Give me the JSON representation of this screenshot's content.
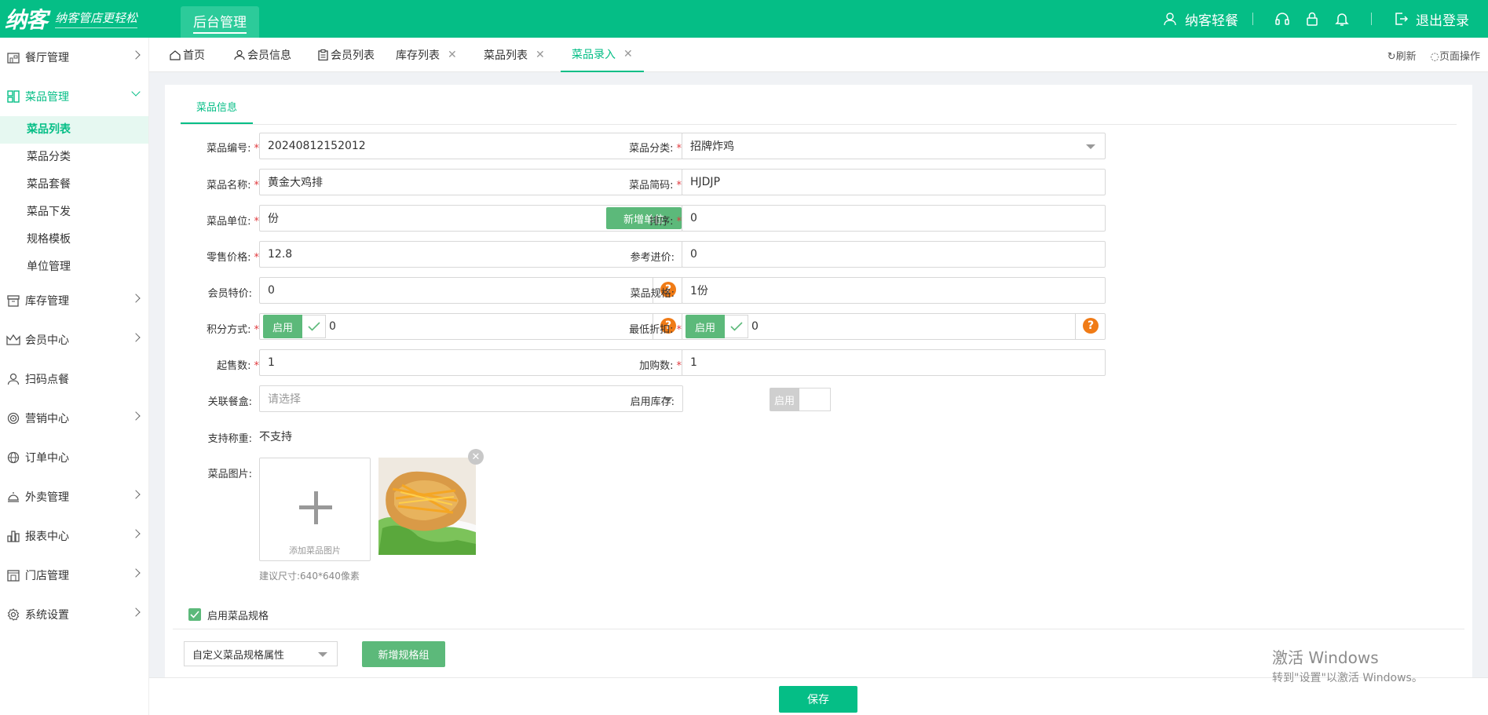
{
  "header": {
    "logo": "纳客",
    "slogan": "纳客管店更轻松",
    "module_tab": "后台管理",
    "user": "纳客轻餐",
    "logout": "退出登录"
  },
  "sidebar": {
    "groups": [
      {
        "label": "餐厅管理",
        "icon": "restaurant-icon"
      },
      {
        "label": "菜品管理",
        "icon": "dish-icon"
      },
      {
        "label": "库存管理",
        "icon": "inventory-icon"
      },
      {
        "label": "会员中心",
        "icon": "crown-icon"
      },
      {
        "label": "扫码点餐",
        "icon": "user-icon"
      },
      {
        "label": "营销中心",
        "icon": "target-icon"
      },
      {
        "label": "订单中心",
        "icon": "globe-icon"
      },
      {
        "label": "外卖管理",
        "icon": "cloche-icon"
      },
      {
        "label": "报表中心",
        "icon": "chart-icon"
      },
      {
        "label": "门店管理",
        "icon": "store-icon"
      },
      {
        "label": "系统设置",
        "icon": "gear-icon"
      }
    ],
    "dish_submenu": [
      "菜品列表",
      "菜品分类",
      "菜品套餐",
      "菜品下发",
      "规格模板",
      "单位管理"
    ]
  },
  "tabs": {
    "items": [
      {
        "label": "首页"
      },
      {
        "label": "会员信息"
      },
      {
        "label": "会员列表"
      },
      {
        "label": "库存列表"
      },
      {
        "label": "菜品列表"
      },
      {
        "label": "菜品录入"
      }
    ],
    "refresh": "刷新",
    "page_ops": "页面操作"
  },
  "form": {
    "section_tab": "菜品信息",
    "dish_code": {
      "label": "菜品编号:",
      "value": "20240812152012"
    },
    "dish_name": {
      "label": "菜品名称:",
      "value": "黄金大鸡排"
    },
    "dish_unit": {
      "label": "菜品单位:",
      "value": "份",
      "button": "新增单位"
    },
    "retail_price": {
      "label": "零售价格:",
      "value": "12.8"
    },
    "member_price": {
      "label": "会员特价:",
      "value": "0"
    },
    "points_mode": {
      "label": "积分方式:",
      "toggle": "启用",
      "value": "0"
    },
    "min_qty": {
      "label": "起售数:",
      "value": "1"
    },
    "lunchbox": {
      "label": "关联餐盒:",
      "placeholder": "请选择"
    },
    "weighing": {
      "label": "支持称重:",
      "value": "不支持"
    },
    "dish_image": {
      "label": "菜品图片:",
      "upload_text": "添加菜品图片",
      "hint": "建议尺寸:640*640像素"
    },
    "category": {
      "label": "菜品分类:",
      "value": "招牌炸鸡"
    },
    "short_code": {
      "label": "菜品简码:",
      "value": "HJDJP"
    },
    "sort": {
      "label": "排序:",
      "value": "0"
    },
    "ref_cost": {
      "label": "参考进价:",
      "value": "0"
    },
    "spec": {
      "label": "菜品规格:",
      "value": "1份"
    },
    "min_discount": {
      "label": "最低折扣:",
      "toggle": "启用",
      "value": "0"
    },
    "add_qty": {
      "label": "加购数:",
      "value": "1"
    },
    "stock": {
      "label": "启用库存:",
      "toggle": "启用"
    },
    "enable_spec": "启用菜品规格",
    "spec_select": "自定义菜品规格属性",
    "add_spec_group": "新增规格组",
    "save": "保存"
  },
  "watermark": {
    "line1": "激活 Windows",
    "line2": "转到\"设置\"以激活 Windows。"
  },
  "colors": {
    "brand": "#05be86",
    "button_green": "#5cb97a",
    "help_orange": "#f07b16",
    "required": "#e0393e"
  }
}
